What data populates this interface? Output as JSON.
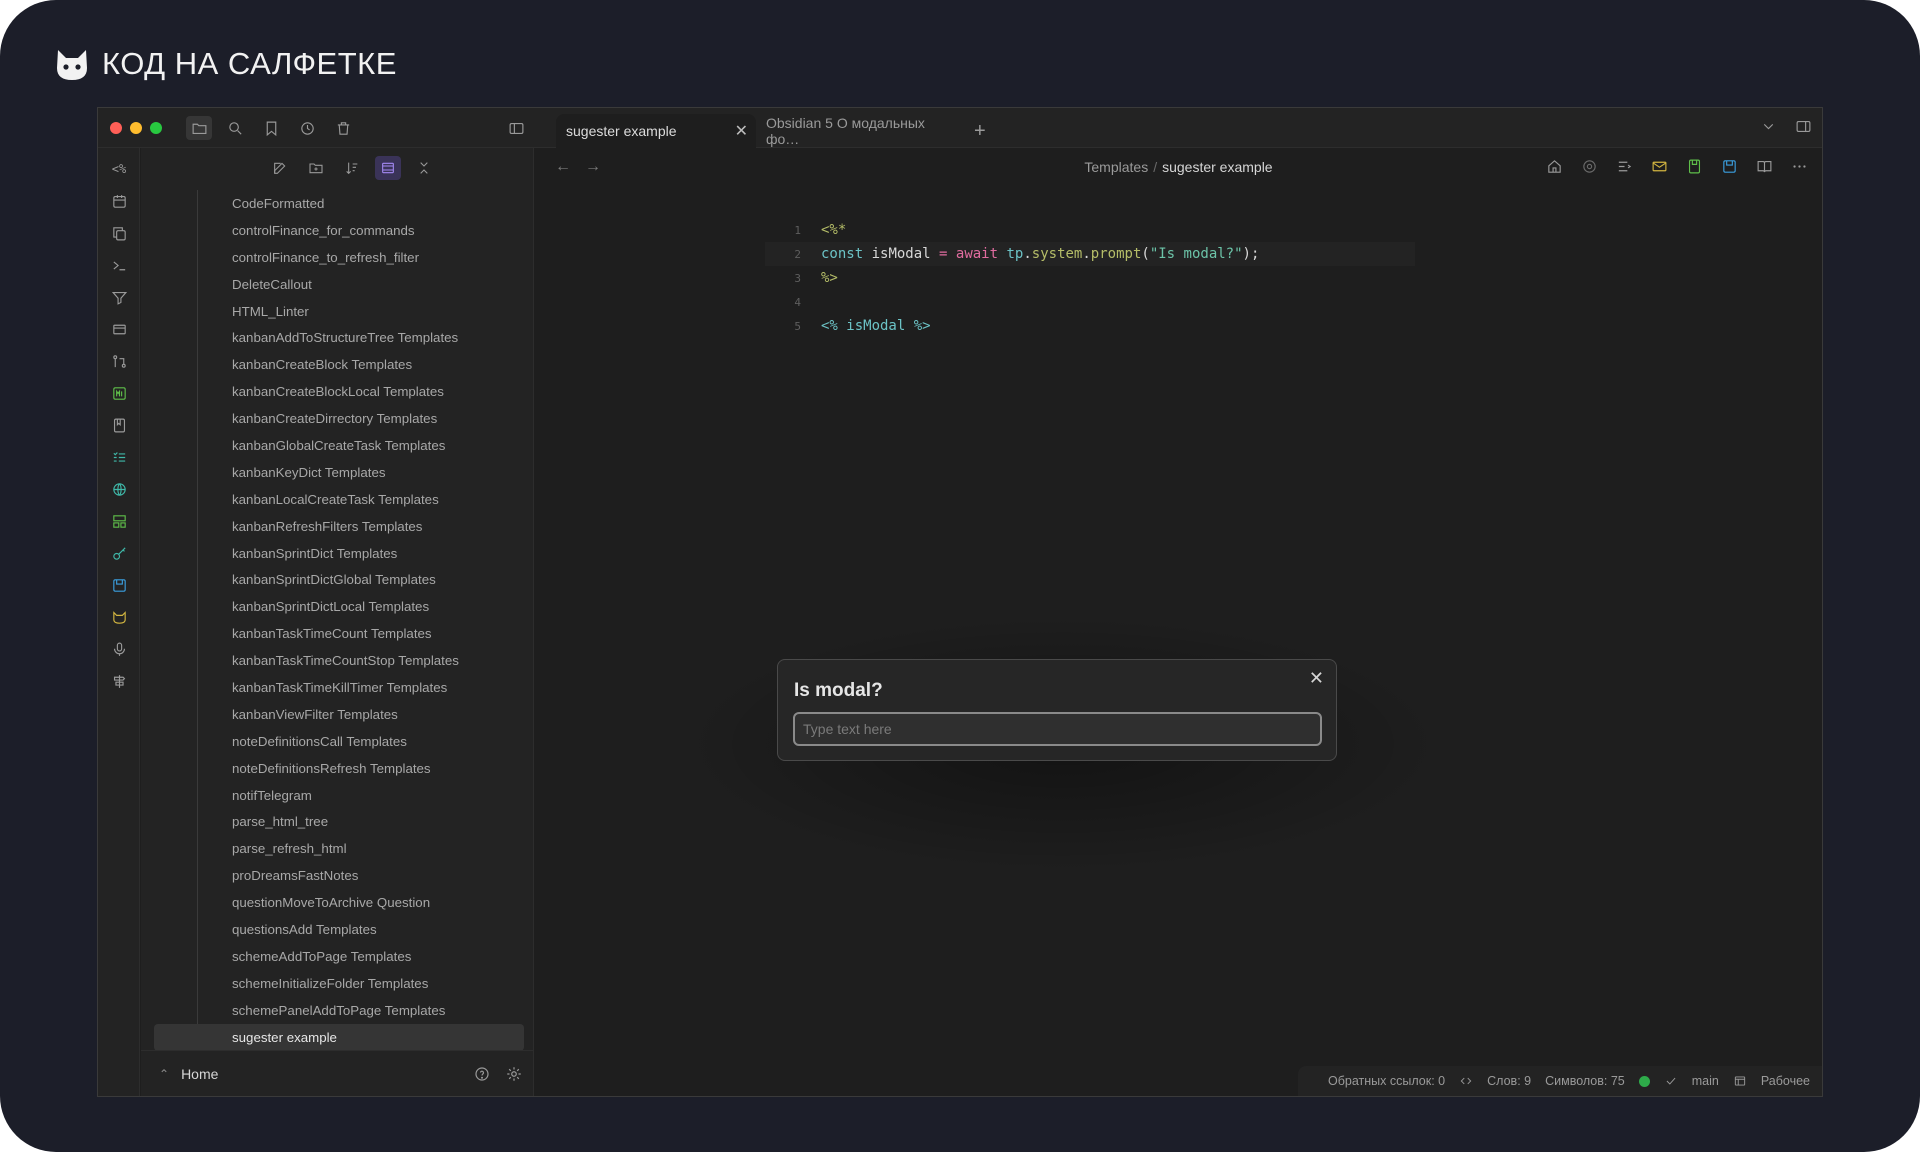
{
  "brand": {
    "name": "КОД НА САЛФЕТКЕ"
  },
  "window": {
    "tabs": [
      {
        "label": "sugester example",
        "active": true
      },
      {
        "label": "Obsidian 5 О модальных фо…",
        "active": false
      }
    ],
    "tab_add": "+",
    "tab_close": "✕"
  },
  "ribbon": {
    "top_label": "<%"
  },
  "explorer": {
    "files": [
      "CodeFormatted",
      "controlFinance_for_commands",
      "controlFinance_to_refresh_filter",
      "DeleteCallout",
      "HTML_Linter",
      "kanbanAddToStructureTree Templates",
      "kanbanCreateBlock Templates",
      "kanbanCreateBlockLocal Templates",
      "kanbanCreateDirrectory Templates",
      "kanbanGlobalCreateTask Templates",
      "kanbanKeyDict Templates",
      "kanbanLocalCreateTask Templates",
      "kanbanRefreshFilters Templates",
      "kanbanSprintDict Templates",
      "kanbanSprintDictGlobal Templates",
      "kanbanSprintDictLocal Templates",
      "kanbanTaskTimeCount Templates",
      "kanbanTaskTimeCountStop Templates",
      "kanbanTaskTimeKillTimer Templates",
      "kanbanViewFilter Templates",
      "noteDefinitionsCall Templates",
      "noteDefinitionsRefresh Templates",
      "notifTelegram",
      "parse_html_tree",
      "parse_refresh_html",
      "proDreamsFastNotes",
      "questionMoveToArchive Question",
      "questionsAdd Templates",
      "schemeAddToPage Templates",
      "schemeInitializeFolder Templates",
      "schemePanelAddToPage Templates",
      "sugester example"
    ],
    "active_file": "sugester example",
    "vault_name": "Home"
  },
  "editor": {
    "breadcrumb": {
      "parent": "Templates",
      "separator": "/",
      "current": "sugester example"
    },
    "lines": [
      {
        "num": "1",
        "tokens": [
          {
            "t": "<%*",
            "c": "tok-tag"
          }
        ]
      },
      {
        "num": "2",
        "active": true,
        "tokens": [
          {
            "t": "const",
            "c": "tok-kw"
          },
          {
            "t": " isModal ",
            "c": "tok-id"
          },
          {
            "t": "=",
            "c": "tok-kw2"
          },
          {
            "t": " ",
            "c": "tok-id"
          },
          {
            "t": "await",
            "c": "tok-kw2"
          },
          {
            "t": " ",
            "c": "tok-id"
          },
          {
            "t": "tp",
            "c": "tok-kw"
          },
          {
            "t": ".",
            "c": "tok-id"
          },
          {
            "t": "system",
            "c": "tok-fn"
          },
          {
            "t": ".",
            "c": "tok-id"
          },
          {
            "t": "prompt",
            "c": "tok-fn"
          },
          {
            "t": "(",
            "c": "tok-id"
          },
          {
            "t": "\"Is modal?\"",
            "c": "tok-str"
          },
          {
            "t": ");",
            "c": "tok-id"
          }
        ]
      },
      {
        "num": "3",
        "tokens": [
          {
            "t": "%>",
            "c": "tok-tag"
          }
        ]
      },
      {
        "num": "4",
        "tokens": []
      },
      {
        "num": "5",
        "tokens": [
          {
            "t": "<% isModal %>",
            "c": "tok-tpl"
          }
        ]
      }
    ]
  },
  "modal": {
    "title": "Is modal?",
    "close": "✕",
    "input_value": "",
    "placeholder": "Type text here"
  },
  "status_bar": {
    "backlinks": "Обратных ссылок: 0",
    "words": "Слов: 9",
    "chars": "Символов: 75",
    "branch": "main",
    "workspace": "Рабочее"
  },
  "colors": {
    "accent_purple": "#a58af5",
    "ribbon_green": "#5fbf4a",
    "ribbon_teal": "#3fb8a8",
    "ribbon_yellow": "#d2b540",
    "ribbon_blue": "#3a9fe0",
    "sync_green": "#2eab4a"
  }
}
